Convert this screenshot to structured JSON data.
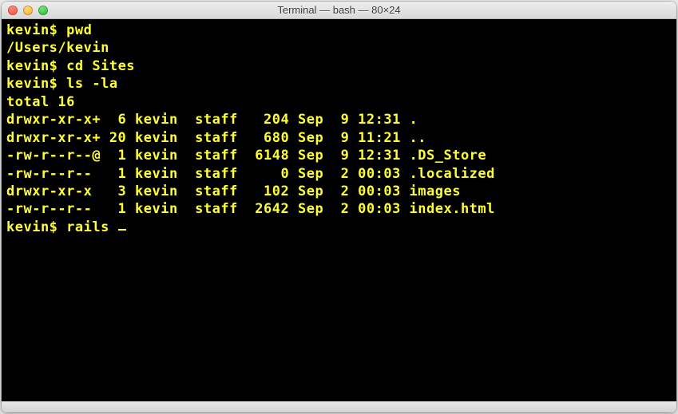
{
  "window": {
    "title": "Terminal — bash — 80×24"
  },
  "history": [
    {
      "prompt": "kevin$ ",
      "command": "pwd"
    },
    {
      "out": "/Users/kevin"
    },
    {
      "prompt": "kevin$ ",
      "command": "cd Sites"
    },
    {
      "prompt": "kevin$ ",
      "command": "ls -la"
    },
    {
      "out": "total 16"
    }
  ],
  "listing": [
    {
      "perm": "drwxr-xr-x+",
      "links": "6",
      "owner": "kevin",
      "grp": "staff",
      "size": "204",
      "mon": "Sep",
      "day": "9",
      "time": "12:31",
      "name": "."
    },
    {
      "perm": "drwxr-xr-x+",
      "links": "20",
      "owner": "kevin",
      "grp": "staff",
      "size": "680",
      "mon": "Sep",
      "day": "9",
      "time": "11:21",
      "name": ".."
    },
    {
      "perm": "-rw-r--r--@",
      "links": "1",
      "owner": "kevin",
      "grp": "staff",
      "size": "6148",
      "mon": "Sep",
      "day": "9",
      "time": "12:31",
      "name": ".DS_Store"
    },
    {
      "perm": "-rw-r--r--",
      "links": "1",
      "owner": "kevin",
      "grp": "staff",
      "size": "0",
      "mon": "Sep",
      "day": "2",
      "time": "00:03",
      "name": ".localized"
    },
    {
      "perm": "drwxr-xr-x",
      "links": "3",
      "owner": "kevin",
      "grp": "staff",
      "size": "102",
      "mon": "Sep",
      "day": "2",
      "time": "00:03",
      "name": "images"
    },
    {
      "perm": "-rw-r--r--",
      "links": "1",
      "owner": "kevin",
      "grp": "staff",
      "size": "2642",
      "mon": "Sep",
      "day": "2",
      "time": "00:03",
      "name": "index.html"
    }
  ],
  "current": {
    "prompt": "kevin$ ",
    "command": "rails "
  }
}
